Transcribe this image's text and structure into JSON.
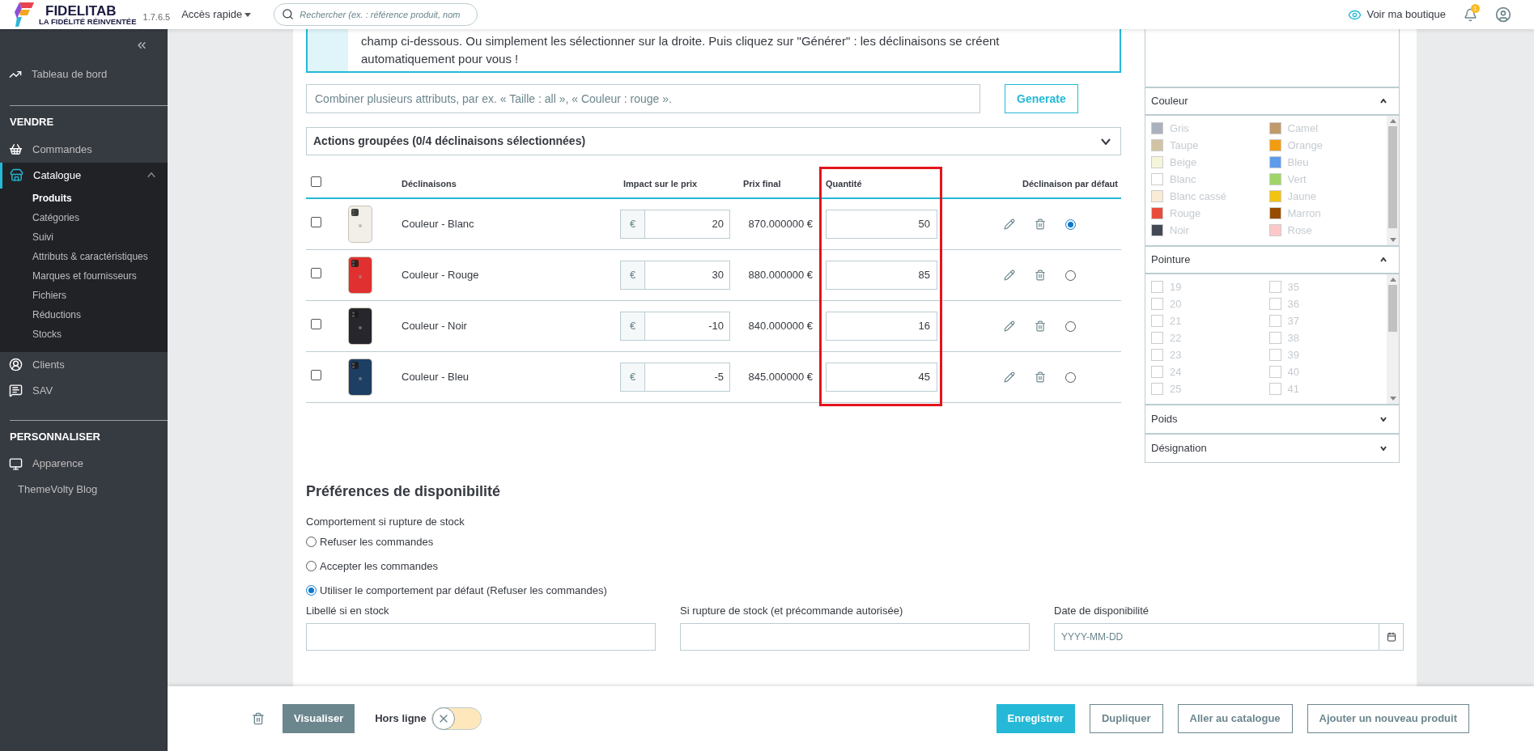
{
  "header": {
    "logo_title": "FIDELITAB",
    "logo_tagline": "LA FIDÉLITÉ RÉINVENTÉE",
    "version": "1.7.6.5",
    "quick_access": "Accès rapide",
    "search": {
      "placeholder": "Rechercher (ex. : référence produit, nom"
    },
    "shop_link": "Voir ma boutique",
    "notifications_count": "1"
  },
  "sidebar": {
    "top_item": {
      "label": "Tableau de bord"
    },
    "sections": [
      {
        "title": "VENDRE",
        "items": [
          {
            "label": "Commandes",
            "selected": false,
            "expanded": false
          },
          {
            "label": "Catalogue",
            "selected": true,
            "expanded": true,
            "children": [
              {
                "label": "Produits",
                "selected": true
              },
              {
                "label": "Catégories",
                "selected": false
              },
              {
                "label": "Suivi",
                "selected": false
              },
              {
                "label": "Attributs & caractéristiques",
                "selected": false
              },
              {
                "label": "Marques et fournisseurs",
                "selected": false
              },
              {
                "label": "Fichiers",
                "selected": false
              },
              {
                "label": "Réductions",
                "selected": false
              },
              {
                "label": "Stocks",
                "selected": false
              }
            ]
          },
          {
            "label": "Clients",
            "selected": false,
            "expanded": false
          },
          {
            "label": "SAV",
            "selected": false,
            "expanded": false
          }
        ]
      },
      {
        "title": "PERSONNALISER",
        "items": [
          {
            "label": "Apparence",
            "selected": false,
            "expanded": false
          },
          {
            "label": "ThemeVolty Blog",
            "selected": false,
            "expanded": false
          }
        ]
      }
    ]
  },
  "info_text": "champ ci-dessous. Ou simplement les sélectionner sur la droite. Puis cliquez sur \"Générer\" : les déclinaisons se créent automatiquement pour vous !",
  "generator": {
    "placeholder": "Combiner plusieurs attributs, par ex. « Taille : all », « Couleur : rouge ».",
    "button": "Generate"
  },
  "bulk_actions": {
    "label": "Actions groupées (0/4 déclinaisons sélectionnées)",
    "expanded": false
  },
  "table": {
    "all_checked": false,
    "columns": [
      "Déclinaisons",
      "Impact sur le prix",
      "Prix final",
      "Quantité",
      "Déclinaison par défaut"
    ],
    "rows": [
      {
        "checked": false,
        "name": "Couleur - Blanc",
        "currency": "€",
        "impact": "20",
        "final_price": "870.000000 €",
        "quantity": "50",
        "selected": true
      },
      {
        "checked": false,
        "name": "Couleur - Rouge",
        "currency": "€",
        "impact": "30",
        "final_price": "880.000000 €",
        "quantity": "85",
        "selected": false
      },
      {
        "checked": false,
        "name": "Couleur - Noir",
        "currency": "€",
        "impact": "-10",
        "final_price": "840.000000 €",
        "quantity": "16",
        "selected": false
      },
      {
        "checked": false,
        "name": "Couleur - Bleu",
        "currency": "€",
        "impact": "-5",
        "final_price": "845.000000 €",
        "quantity": "45",
        "selected": false
      }
    ]
  },
  "filters": [
    {
      "title": "Couleur",
      "kind": "colors",
      "expanded": true,
      "items": [
        {
          "label": "Gris",
          "color": "#aab2bd"
        },
        {
          "label": "Camel",
          "color": "#c19a6b"
        },
        {
          "label": "Taupe",
          "color": "#d0c4a5"
        },
        {
          "label": "Orange",
          "color": "#f39c11"
        },
        {
          "label": "Beige",
          "color": "#f5f5dc"
        },
        {
          "label": "Bleu",
          "color": "#5d9cec"
        },
        {
          "label": "Blanc",
          "color": "#ffffff"
        },
        {
          "label": "Vert",
          "color": "#a0d468"
        },
        {
          "label": "Blanc cassé",
          "color": "#faebd7"
        },
        {
          "label": "Jaune",
          "color": "#f1c40f"
        },
        {
          "label": "Rouge",
          "color": "#e84c3d"
        },
        {
          "label": "Marron",
          "color": "#964b00"
        },
        {
          "label": "Noir",
          "color": "#434a54"
        },
        {
          "label": "Rose",
          "color": "#fcc8c8"
        }
      ]
    },
    {
      "title": "Pointure",
      "kind": "sizes",
      "expanded": true,
      "items": [
        {
          "label": "19",
          "checked": false
        },
        {
          "label": "35",
          "checked": false
        },
        {
          "label": "20",
          "checked": false
        },
        {
          "label": "36",
          "checked": false
        },
        {
          "label": "21",
          "checked": false
        },
        {
          "label": "37",
          "checked": false
        },
        {
          "label": "22",
          "checked": false
        },
        {
          "label": "38",
          "checked": false
        },
        {
          "label": "23",
          "checked": false
        },
        {
          "label": "39",
          "checked": false
        },
        {
          "label": "24",
          "checked": false
        },
        {
          "label": "40",
          "checked": false
        },
        {
          "label": "25",
          "checked": false
        },
        {
          "label": "41",
          "checked": false
        }
      ]
    },
    {
      "title": "Poids",
      "expanded": false
    },
    {
      "title": "Désignation",
      "expanded": false
    }
  ],
  "availability": {
    "title": "Préférences de disponibilité",
    "behavior_label": "Comportement si rupture de stock",
    "options": [
      {
        "label": "Refuser les commandes",
        "selected": false
      },
      {
        "label": "Accepter les commandes",
        "selected": false
      },
      {
        "label": "Utiliser le comportement par défaut (Refuser les commandes)",
        "selected": true
      }
    ],
    "fields": [
      {
        "label": "Libellé si en stock",
        "kind": "text"
      },
      {
        "label": "Si rupture de stock (et précommande autorisée)",
        "kind": "text"
      },
      {
        "label": "Date de disponibilité",
        "kind": "date",
        "placeholder": "YYYY-MM-DD"
      }
    ]
  },
  "footer": {
    "preview": "Visualiser",
    "offline_label": "Hors ligne",
    "online": false,
    "buttons": [
      {
        "label": "Enregistrer",
        "kind": "primary"
      },
      {
        "label": "Dupliquer",
        "kind": "secondary"
      },
      {
        "label": "Aller au catalogue",
        "kind": "secondary"
      },
      {
        "label": "Ajouter un nouveau produit",
        "kind": "secondary"
      }
    ]
  }
}
